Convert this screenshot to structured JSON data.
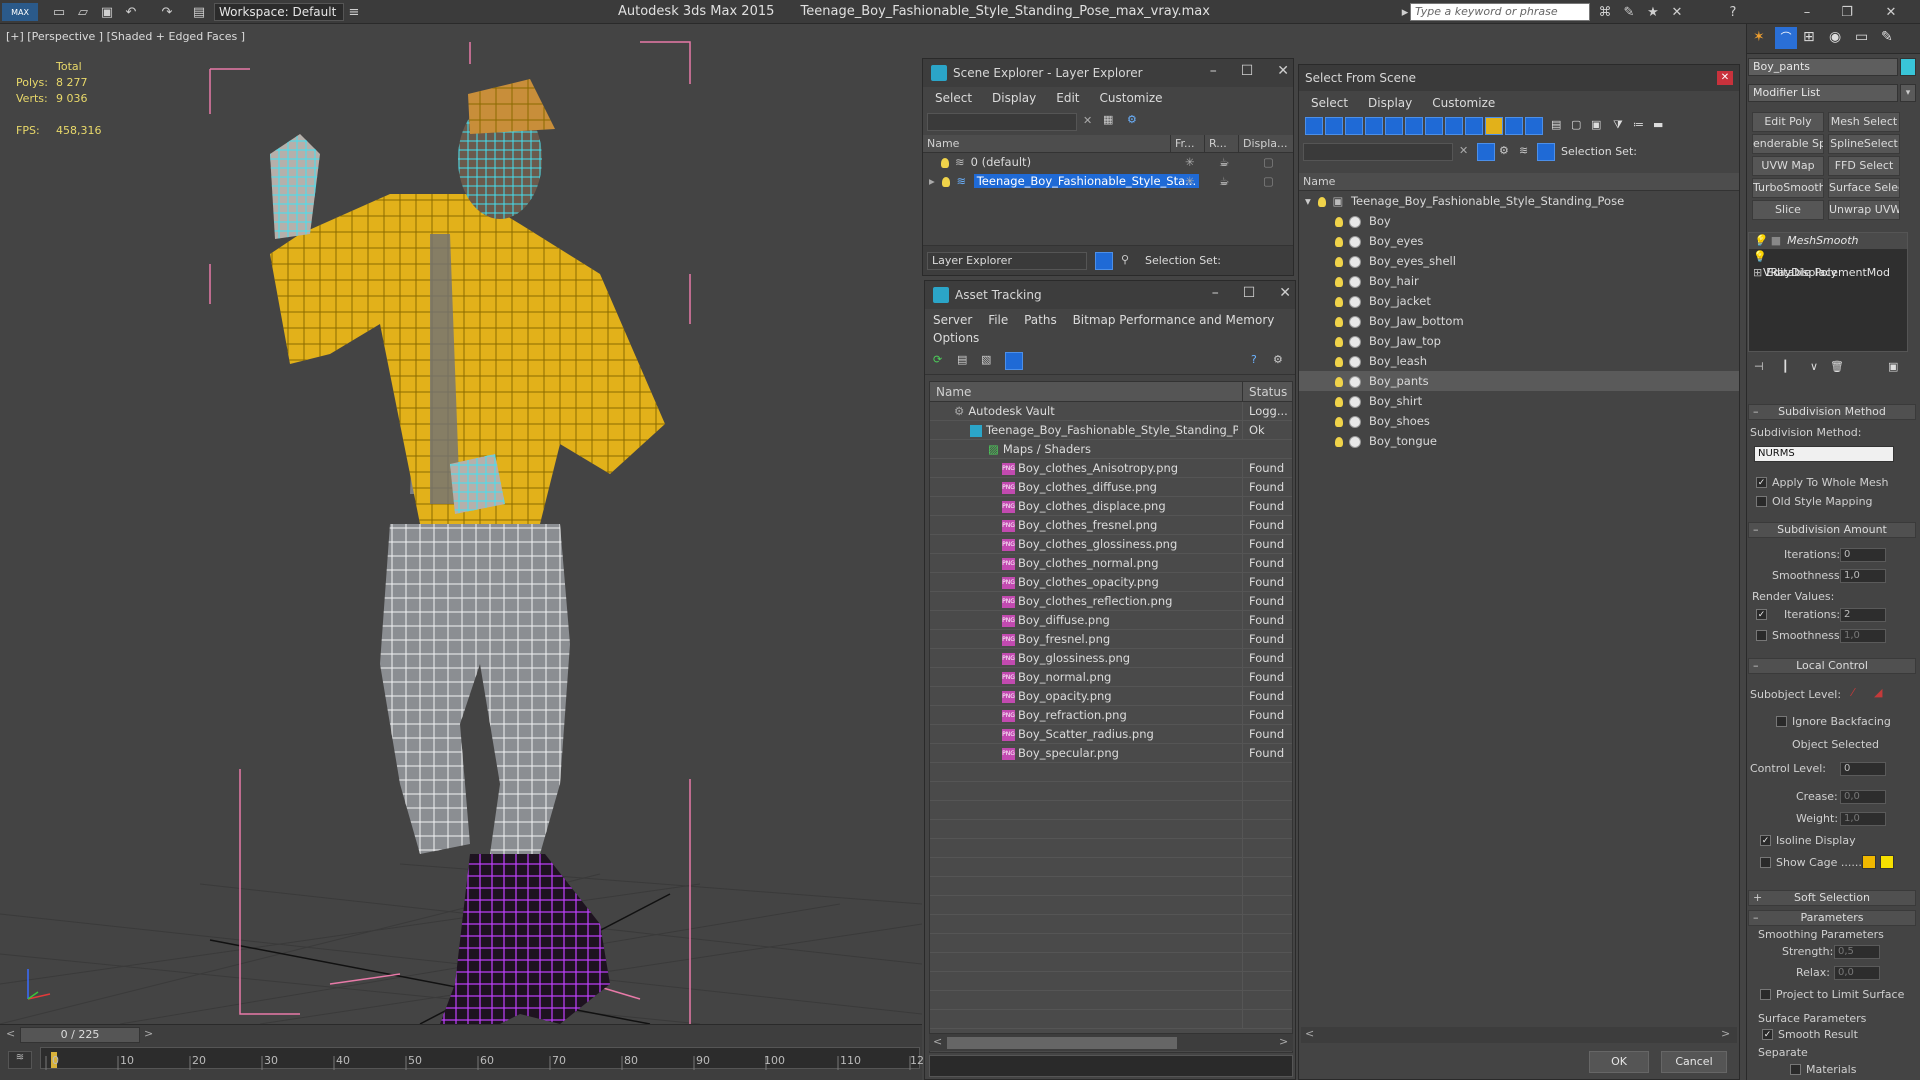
{
  "titlebar": {
    "max_logo": "MAX",
    "workspace": "Workspace: Default",
    "app_name": "Autodesk 3ds Max  2015",
    "file_name": "Teenage_Boy_Fashionable_Style_Standing_Pose_max_vray.max",
    "search_placeholder": "Type a keyword or phrase"
  },
  "viewport": {
    "label": "[+] [Perspective ] [Shaded + Edged Faces ]",
    "stats": {
      "total_label": "Total",
      "polys_label": "Polys:",
      "polys_value": "8 277",
      "verts_label": "Verts:",
      "verts_value": "9 036",
      "fps_label": "FPS:",
      "fps_value": "458,316"
    }
  },
  "timeline": {
    "frame_display": "0 / 225",
    "ticks": [
      "0",
      "10",
      "20",
      "30",
      "40",
      "50",
      "60",
      "70",
      "80",
      "90",
      "100",
      "110",
      "12"
    ]
  },
  "scene_explorer": {
    "title": "Scene Explorer - Layer Explorer",
    "menu": [
      "Select",
      "Display",
      "Edit",
      "Customize"
    ],
    "columns": [
      "Name",
      "Fr...",
      "R...",
      "Displa..."
    ],
    "rows": [
      {
        "label": "0 (default)",
        "selected": false
      },
      {
        "label": "Teenage_Boy_Fashionable_Style_Sta...",
        "selected": true
      }
    ],
    "footer_dropdown": "Layer Explorer",
    "footer_selection_set": "Selection Set:"
  },
  "asset_tracking": {
    "title": "Asset Tracking",
    "menu": [
      "Server",
      "File",
      "Paths",
      "Bitmap Performance and Memory",
      "Options"
    ],
    "columns": [
      "Name",
      "Status"
    ],
    "vault": {
      "name": "Autodesk Vault",
      "status": "Logg..."
    },
    "scene_file": {
      "name": "Teenage_Boy_Fashionable_Style_Standing_Po...",
      "status": "Ok"
    },
    "maps_folder": "Maps / Shaders",
    "files": [
      {
        "name": "Boy_clothes_Anisotropy.png",
        "status": "Found"
      },
      {
        "name": "Boy_clothes_diffuse.png",
        "status": "Found"
      },
      {
        "name": "Boy_clothes_displace.png",
        "status": "Found"
      },
      {
        "name": "Boy_clothes_fresnel.png",
        "status": "Found"
      },
      {
        "name": "Boy_clothes_glossiness.png",
        "status": "Found"
      },
      {
        "name": "Boy_clothes_normal.png",
        "status": "Found"
      },
      {
        "name": "Boy_clothes_opacity.png",
        "status": "Found"
      },
      {
        "name": "Boy_clothes_reflection.png",
        "status": "Found"
      },
      {
        "name": "Boy_diffuse.png",
        "status": "Found"
      },
      {
        "name": "Boy_fresnel.png",
        "status": "Found"
      },
      {
        "name": "Boy_glossiness.png",
        "status": "Found"
      },
      {
        "name": "Boy_normal.png",
        "status": "Found"
      },
      {
        "name": "Boy_opacity.png",
        "status": "Found"
      },
      {
        "name": "Boy_refraction.png",
        "status": "Found"
      },
      {
        "name": "Boy_Scatter_radius.png",
        "status": "Found"
      },
      {
        "name": "Boy_specular.png",
        "status": "Found"
      }
    ]
  },
  "select_from_scene": {
    "title": "Select From Scene",
    "menu": [
      "Select",
      "Display",
      "Customize"
    ],
    "selection_set_label": "Selection Set:",
    "column_name": "Name",
    "root": "Teenage_Boy_Fashionable_Style_Standing_Pose",
    "objects": [
      {
        "label": "Boy",
        "highlight": false
      },
      {
        "label": "Boy_eyes",
        "highlight": false
      },
      {
        "label": "Boy_eyes_shell",
        "highlight": false
      },
      {
        "label": "Boy_hair",
        "highlight": false
      },
      {
        "label": "Boy_jacket",
        "highlight": false
      },
      {
        "label": "Boy_Jaw_bottom",
        "highlight": false
      },
      {
        "label": "Boy_Jaw_top",
        "highlight": false
      },
      {
        "label": "Boy_leash",
        "highlight": false
      },
      {
        "label": "Boy_pants",
        "highlight": true
      },
      {
        "label": "Boy_shirt",
        "highlight": false
      },
      {
        "label": "Boy_shoes",
        "highlight": false
      },
      {
        "label": "Boy_tongue",
        "highlight": false
      }
    ],
    "ok_label": "OK",
    "cancel_label": "Cancel"
  },
  "command_panel": {
    "object_name": "Boy_pants",
    "modifier_list": "Modifier List",
    "buttons": [
      "Edit Poly",
      "Mesh Select",
      "enderable Splir",
      "SplineSelect",
      "UVW Map",
      "FFD Select",
      "TurboSmooth",
      "Surface Select",
      "Slice",
      "Unwrap UVW"
    ],
    "stack": [
      "MeshSmooth",
      "VRayDisplacementMod",
      "Editable Poly"
    ],
    "subdivision_method": {
      "header": "Subdivision Method",
      "label": "Subdivision Method:",
      "value": "NURMS",
      "apply_whole_mesh": "Apply To Whole Mesh",
      "old_style_mapping": "Old Style Mapping"
    },
    "subdivision_amount": {
      "header": "Subdivision Amount",
      "iterations_label": "Iterations:",
      "iterations_value": "0",
      "smoothness_label": "Smoothness:",
      "smoothness_value": "1,0",
      "render_values": "Render Values:",
      "r_iterations_label": "Iterations:",
      "r_iterations_value": "2",
      "r_smoothness_label": "Smoothness:",
      "r_smoothness_value": "1,0"
    },
    "local_control": {
      "header": "Local Control",
      "subobject_level": "Subobject Level:",
      "ignore_backfacing": "Ignore Backfacing",
      "object_selected": "Object Selected",
      "control_level_label": "Control Level:",
      "control_level_value": "0",
      "crease_label": "Crease:",
      "crease_value": "0,0",
      "weight_label": "Weight:",
      "weight_value": "1,0",
      "isoline_display": "Isoline Display",
      "show_cage": "Show Cage ......"
    },
    "soft_selection": "Soft Selection",
    "parameters": {
      "header": "Parameters",
      "smoothing_parameters": "Smoothing Parameters",
      "strength_label": "Strength:",
      "strength_value": "0,5",
      "relax_label": "Relax:",
      "relax_value": "0,0",
      "project_limit": "Project to Limit Surface",
      "surface_parameters": "Surface Parameters",
      "smooth_result": "Smooth Result",
      "separate": "Separate",
      "materials": "Materials"
    }
  },
  "colors": {
    "jacket": "#e2b11a",
    "wire_cyan": "#44e0f0",
    "shoes": "#b02adf",
    "selection_blue": "#1f6ad6",
    "bbox_pink": "#e87aa8"
  }
}
